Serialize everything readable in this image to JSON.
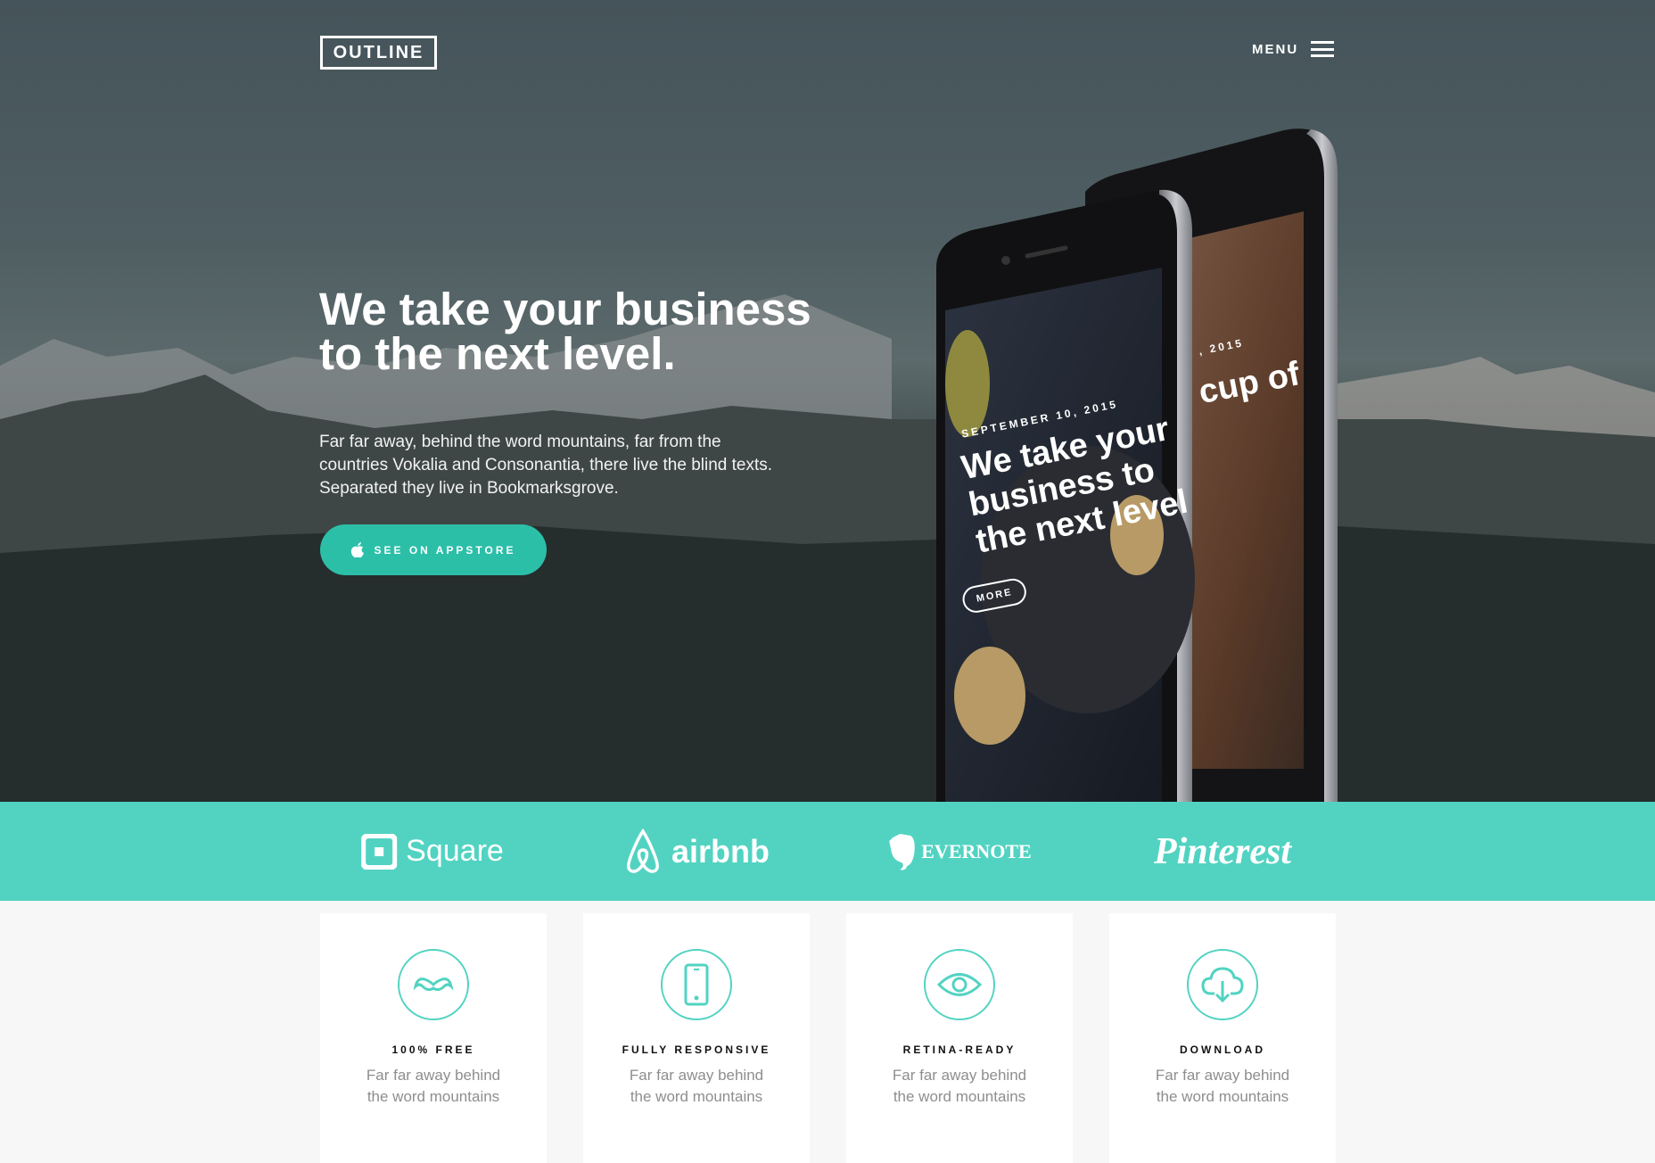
{
  "header": {
    "logo": "OUTLINE",
    "menu_label": "MENU",
    "menu_icon": "hamburger-icon"
  },
  "hero": {
    "title": "We take your business to the next level.",
    "text": "Far far away, behind the word mountains, far from the countries Vokalia and Consonantia, there live the blind texts. Separated they live in Bookmarksgrove.",
    "cta_label": "SEE ON APPSTORE",
    "cta_icon": "apple-icon"
  },
  "phone_front": {
    "date": "SEPTEMBER 10, 2015",
    "line1": "We take your",
    "line2": "business to",
    "line3": "the next level",
    "more": "MORE"
  },
  "phone_back": {
    "date": ", 2015",
    "title": "cup of"
  },
  "brands": [
    "Square",
    "airbnb",
    "EVERNOTE",
    "Pinterest"
  ],
  "features": [
    {
      "icon": "mustache-icon",
      "title": "100% FREE",
      "text": "Far far away behind the word mountains"
    },
    {
      "icon": "smartphone-icon",
      "title": "FULLY RESPONSIVE",
      "text": "Far far away behind the word mountains"
    },
    {
      "icon": "eye-icon",
      "title": "RETINA-READY",
      "text": "Far far away behind the word mountains"
    },
    {
      "icon": "cloud-download-icon",
      "title": "DOWNLOAD",
      "text": "Far far away behind the word mountains"
    }
  ],
  "colors": {
    "accent": "#52d3c2",
    "button": "#2bbfa8"
  }
}
